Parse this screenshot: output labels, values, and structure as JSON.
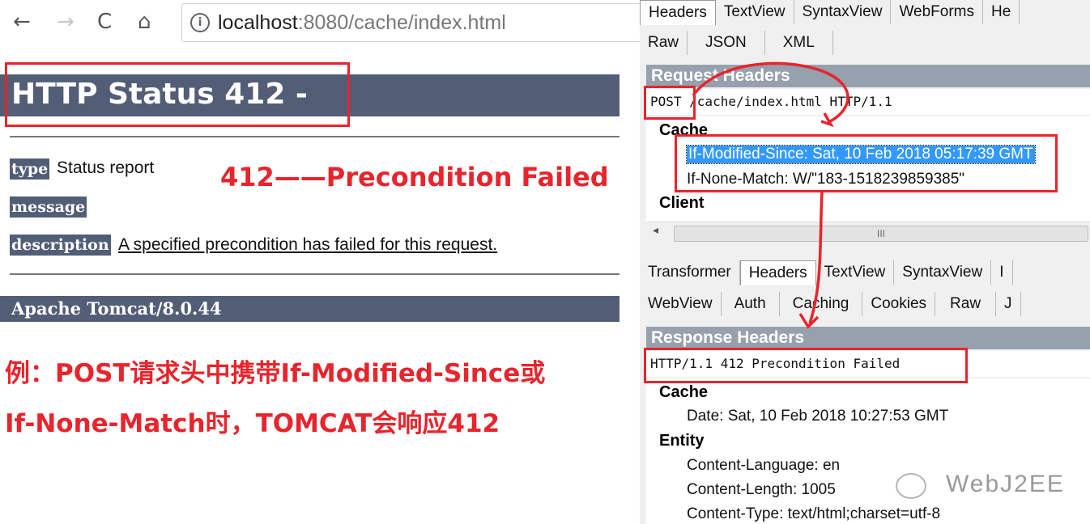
{
  "browser": {
    "back_icon": "←",
    "forward_icon": "→",
    "reload_icon": "C",
    "home_icon": "⌂",
    "info_icon": "i",
    "url_host": "localhost",
    "url_rest": ":8080/cache/index.html"
  },
  "page": {
    "title": "HTTP Status 412 -",
    "rows": [
      {
        "label": "type",
        "value": "Status report"
      },
      {
        "label": "message",
        "value": ""
      },
      {
        "label": "description",
        "value": "A specified precondition has failed for this request."
      }
    ],
    "footer": "Apache Tomcat/8.0.44"
  },
  "annotations": {
    "status_note": "412——Precondition Failed",
    "example_line1": "例：POST请求头中携带If-Modified-Since或",
    "example_line2": "If-None-Match时，TOMCAT会响应412"
  },
  "fiddler": {
    "request_tabs": [
      "Headers",
      "TextView",
      "SyntaxView",
      "WebForms",
      "He"
    ],
    "request_subtabs": [
      "Raw",
      "JSON",
      "XML"
    ],
    "request_section": "Request Headers",
    "request_method": "POST",
    "request_line": " /cache/index.html HTTP/1.1",
    "request_groups": {
      "cache": "Cache",
      "if_modified_since": "If-Modified-Since: Sat, 10 Feb 2018 05:17:39 GMT",
      "if_none_match": "If-None-Match: W/\"183-1518239859385\"",
      "client": "Client"
    },
    "scroll_grip": "III",
    "scroll_left_icon": "◂",
    "response_tabs": [
      "Transformer",
      "Headers",
      "TextView",
      "SyntaxView",
      "I"
    ],
    "response_subtabs": [
      "WebView",
      "Auth",
      "Caching",
      "Cookies",
      "Raw",
      "J"
    ],
    "response_section": "Response Headers",
    "response_line": "HTTP/1.1 412 Precondition Failed",
    "response_groups": {
      "cache": "Cache",
      "date": "Date: Sat, 10 Feb 2018 10:27:53 GMT",
      "entity": "Entity",
      "content_language": "Content-Language: en",
      "content_length": "Content-Length: 1005",
      "content_type": "Content-Type: text/html;charset=utf-8"
    }
  },
  "watermark": "WebJ2EE",
  "colors": {
    "highlight": "#e8242c",
    "tomcat_bar": "#525d76",
    "fiddler_section": "#97a0ad",
    "selection": "#3399ff"
  }
}
